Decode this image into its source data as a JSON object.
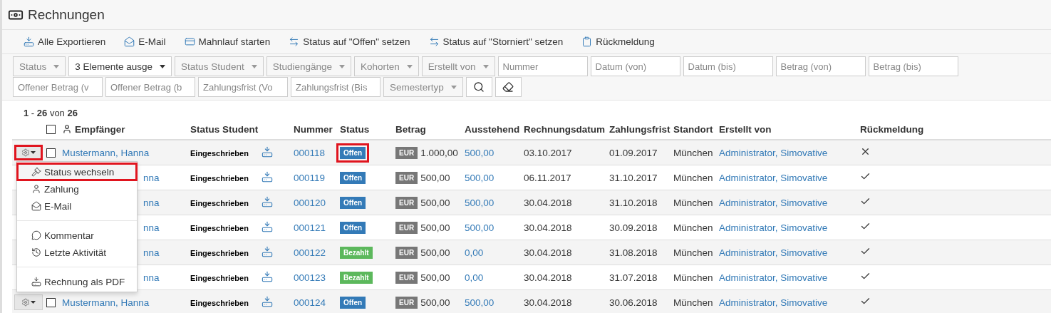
{
  "page": {
    "title": "Rechnungen"
  },
  "toolbar": [
    "Alle Exportieren",
    "E-Mail",
    "Mahnlauf starten",
    "Status auf \"Offen\" setzen",
    "Status auf \"Storniert\" setzen",
    "Rückmeldung"
  ],
  "filters": [
    {
      "kind": "dropdown",
      "label": "Status",
      "selected": false
    },
    {
      "kind": "dropdown",
      "label": "3 Elemente ausge",
      "selected": true
    },
    {
      "kind": "dropdown",
      "label": "Status Student",
      "selected": false
    },
    {
      "kind": "dropdown",
      "label": "Studiengänge",
      "selected": false
    },
    {
      "kind": "dropdown",
      "label": "Kohorten",
      "selected": false
    },
    {
      "kind": "dropdown",
      "label": "Erstellt von",
      "selected": false
    },
    {
      "kind": "input",
      "placeholder": "Nummer"
    },
    {
      "kind": "input",
      "placeholder": "Datum (von)"
    },
    {
      "kind": "input",
      "placeholder": "Datum (bis)"
    },
    {
      "kind": "input",
      "placeholder": "Betrag (von)"
    },
    {
      "kind": "input",
      "placeholder": "Betrag (bis)"
    },
    {
      "kind": "input",
      "placeholder": "Offener Betrag (v"
    },
    {
      "kind": "input",
      "placeholder": "Offener Betrag (b"
    },
    {
      "kind": "input",
      "placeholder": "Zahlungsfrist (Vo"
    },
    {
      "kind": "input",
      "placeholder": "Zahlungsfrist (Bis"
    },
    {
      "kind": "dropdown",
      "label": "Semestertyp",
      "selected": false
    },
    {
      "kind": "search"
    },
    {
      "kind": "clear"
    }
  ],
  "table": {
    "count": "**1** - **26** von **26**",
    "select_all_checked": false,
    "columns": [
      "Empfänger",
      "Status Student",
      "Nummer",
      "Status",
      "Betrag",
      "Ausstehend",
      "Rechnungsdatum",
      "Zahlungsfrist",
      "Standort",
      "Erstellt von",
      "Rückmeldung"
    ],
    "rows": [
      {
        "actions": {
          "highlighted": true,
          "checked": false
        },
        "recipient": "Mustermann, Hanna",
        "status_student": "Eingeschrieben",
        "number": "000118",
        "status": {
          "label": "Offen",
          "kind": "open",
          "highlighted": true
        },
        "currency": "EUR",
        "amount": "1.000,00",
        "outstanding": "500,00",
        "invoice_date": "03.10.2017",
        "due": "01.09.2017",
        "location": "München",
        "created_by": "Administrator, Simovative",
        "feedback_received": false
      },
      {
        "recipient": "nna",
        "status_student": "Eingeschrieben",
        "number": "000119",
        "status": {
          "label": "Offen",
          "kind": "open",
          "highlighted": false
        },
        "currency": "EUR",
        "amount": "500,00",
        "outstanding": "500,00",
        "invoice_date": "06.11.2017",
        "due": "31.10.2017",
        "location": "München",
        "created_by": "Administrator, Simovative",
        "feedback_received": true
      },
      {
        "recipient": "nna",
        "status_student": "Eingeschrieben",
        "number": "000120",
        "status": {
          "label": "Offen",
          "kind": "open",
          "highlighted": false
        },
        "currency": "EUR",
        "amount": "500,00",
        "outstanding": "500,00",
        "invoice_date": "30.04.2018",
        "due": "31.10.2018",
        "location": "München",
        "created_by": "Administrator, Simovative",
        "feedback_received": true
      },
      {
        "recipient": "nna",
        "status_student": "Eingeschrieben",
        "number": "000121",
        "status": {
          "label": "Offen",
          "kind": "open",
          "highlighted": false
        },
        "currency": "EUR",
        "amount": "500,00",
        "outstanding": "500,00",
        "invoice_date": "30.04.2018",
        "due": "30.09.2018",
        "location": "München",
        "created_by": "Administrator, Simovative",
        "feedback_received": true
      },
      {
        "recipient": "nna",
        "status_student": "Eingeschrieben",
        "number": "000122",
        "status": {
          "label": "Bezahlt",
          "kind": "paid",
          "highlighted": false
        },
        "currency": "EUR",
        "amount": "500,00",
        "outstanding": "0,00",
        "invoice_date": "30.04.2018",
        "due": "31.08.2018",
        "location": "München",
        "created_by": "Administrator, Simovative",
        "feedback_received": true
      },
      {
        "recipient": "nna",
        "status_student": "Eingeschrieben",
        "number": "000123",
        "status": {
          "label": "Bezahlt",
          "kind": "paid",
          "highlighted": false
        },
        "currency": "EUR",
        "amount": "500,00",
        "outstanding": "0,00",
        "invoice_date": "30.04.2018",
        "due": "31.07.2018",
        "location": "München",
        "created_by": "Administrator, Simovative",
        "feedback_received": true
      },
      {
        "actions": {
          "highlighted": false,
          "checked": false
        },
        "recipient": "Mustermann, Hanna",
        "status_student": "Eingeschrieben",
        "number": "000124",
        "status": {
          "label": "Offen",
          "kind": "open",
          "highlighted": false
        },
        "currency": "EUR",
        "amount": "500,00",
        "outstanding": "500,00",
        "invoice_date": "30.04.2018",
        "due": "30.06.2018",
        "location": "München",
        "created_by": "Administrator, Simovative",
        "feedback_received": true
      }
    ]
  },
  "action_menu": {
    "items": [
      {
        "kind": "item",
        "label": "Status wechseln",
        "highlighted": true
      },
      {
        "kind": "item",
        "label": "Zahlung",
        "highlighted": false
      },
      {
        "kind": "item",
        "label": "E-Mail",
        "highlighted": false
      },
      {
        "kind": "divider"
      },
      {
        "kind": "item",
        "label": "Kommentar",
        "highlighted": false
      },
      {
        "kind": "item",
        "label": "Letzte Aktivität",
        "highlighted": false
      },
      {
        "kind": "divider"
      },
      {
        "kind": "item",
        "label": "Rechnung als PDF",
        "highlighted": false
      }
    ]
  }
}
